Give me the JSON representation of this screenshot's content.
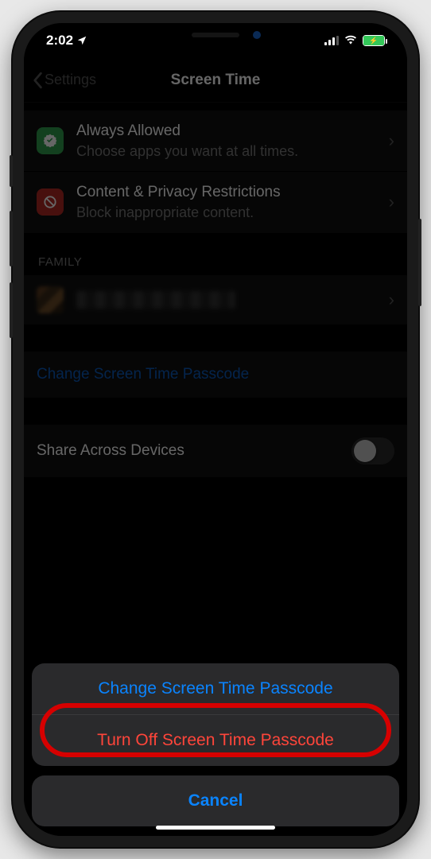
{
  "status": {
    "time": "2:02",
    "battery_charging": true
  },
  "nav": {
    "back_label": "Settings",
    "title": "Screen Time"
  },
  "rows": {
    "always": {
      "title": "Always Allowed",
      "subtitle": "Choose apps you want at all times."
    },
    "content_privacy": {
      "title": "Content & Privacy Restrictions",
      "subtitle": "Block inappropriate content."
    }
  },
  "family_header": "FAMILY",
  "change_passcode_link": "Change Screen Time Passcode",
  "share_devices_label": "Share Across Devices",
  "sheet": {
    "change": "Change Screen Time Passcode",
    "turn_off": "Turn Off Screen Time Passcode",
    "cancel": "Cancel"
  },
  "colors": {
    "accent_blue": "#0a84ff",
    "destructive_red": "#ff453a",
    "annotation_red": "#d60000"
  }
}
